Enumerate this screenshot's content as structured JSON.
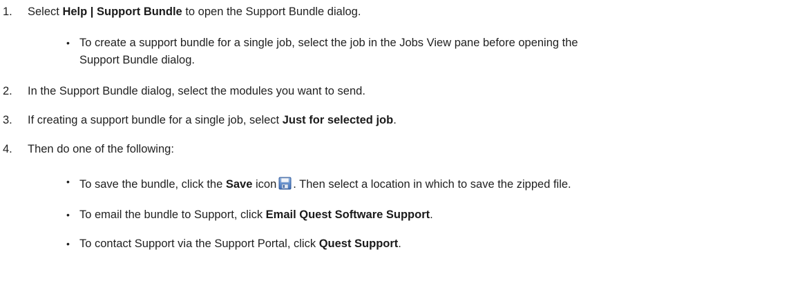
{
  "steps": [
    {
      "number": "1.",
      "text_before": "Select ",
      "bold": "Help | Support Bundle",
      "text_after": " to open the Support Bundle dialog.",
      "sub_items": [
        {
          "line1": "To create a support bundle for a single job, select the job in the Jobs View pane before opening the",
          "line2": "Support Bundle dialog."
        }
      ]
    },
    {
      "number": "2.",
      "text": "In the Support Bundle dialog, select the modules you want to send."
    },
    {
      "number": "3.",
      "text_before": "If creating a support bundle for a single job, select ",
      "bold": "Just for selected job",
      "text_after": "."
    },
    {
      "number": "4.",
      "text": "Then do one of the following:",
      "sub_items": [
        {
          "text_before": "To save the bundle, click the ",
          "bold": "Save",
          "text_mid": " icon",
          "icon": "save-disk-icon",
          "text_after": ". Then select a location in which to save the zipped file."
        },
        {
          "text_before": "To email the bundle to Support, click ",
          "bold": "Email Quest Software Support",
          "text_after": "."
        },
        {
          "text_before": "To contact Support via the Support Portal, click ",
          "bold": "Quest Support",
          "text_after": "."
        }
      ]
    }
  ],
  "bullet_glyph": "•"
}
